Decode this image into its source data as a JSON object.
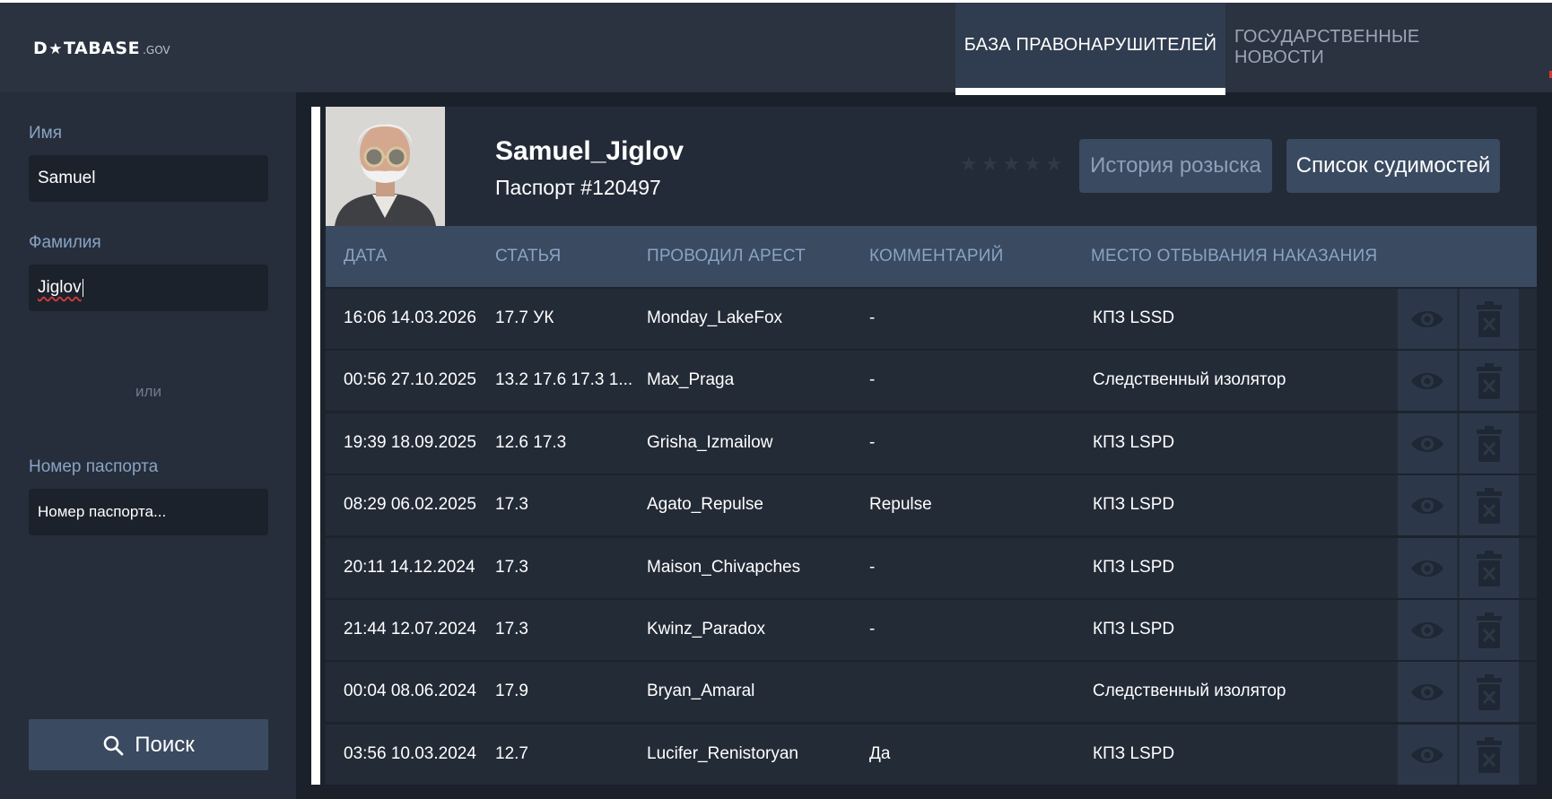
{
  "header": {
    "logo": {
      "main_before": "D",
      "main_after": "TABASE",
      "suffix": ".GOV"
    },
    "tabs": [
      {
        "label": "БАЗА ПРАВОНАРУШИТЕЛЕЙ",
        "active": true
      },
      {
        "label": "ГОСУДАРСТВЕННЫЕ НОВОСТИ",
        "active": false
      }
    ]
  },
  "sidebar": {
    "first_name_label": "Имя",
    "first_name_value": "Samuel",
    "last_name_label": "Фамилия",
    "last_name_value": "Jiglov",
    "or_text": "или",
    "passport_label": "Номер паспорта",
    "passport_placeholder": "Номер паспорта...",
    "search_button": "Поиск"
  },
  "profile": {
    "name": "Samuel_Jiglov",
    "passport": "Паспорт #120497",
    "wanted_stars": 5,
    "wanted_level": 0,
    "history_button": "История розыска",
    "convictions_button": "Список судимостей"
  },
  "table": {
    "columns": [
      "ДАТА",
      "СТАТЬЯ",
      "ПРОВОДИЛ АРЕСТ",
      "КОММЕНТАРИЙ",
      "МЕСТО ОТБЫВАНИЯ НАКАЗАНИЯ"
    ],
    "rows": [
      {
        "date": "16:06 14.03.2026",
        "article": "17.7 УК",
        "officer": "Monday_LakeFox",
        "comment": "-",
        "place": "КПЗ LSSD"
      },
      {
        "date": "00:56 27.10.2025",
        "article": "13.2 17.6 17.3 1...",
        "officer": "Max_Praga",
        "comment": "-",
        "place": "Следственный изолятор"
      },
      {
        "date": "19:39 18.09.2025",
        "article": "12.6 17.3",
        "officer": "Grisha_Izmailow",
        "comment": "-",
        "place": "КПЗ LSPD"
      },
      {
        "date": "08:29 06.02.2025",
        "article": "17.3",
        "officer": "Agato_Repulse",
        "comment": "Repulse",
        "place": "КПЗ LSPD"
      },
      {
        "date": "20:11 14.12.2024",
        "article": "17.3",
        "officer": "Maison_Chivapches",
        "comment": "-",
        "place": "КПЗ LSPD"
      },
      {
        "date": "21:44 12.07.2024",
        "article": "17.3",
        "officer": "Kwinz_Paradox",
        "comment": "-",
        "place": "КПЗ LSPD"
      },
      {
        "date": "00:04 08.06.2024",
        "article": "17.9",
        "officer": "Bryan_Amaral",
        "comment": "",
        "place": "Следственный изолятор"
      },
      {
        "date": "03:56 10.03.2024",
        "article": "12.7",
        "officer": "Lucifer_Renistoryan",
        "comment": "Да",
        "place": "КПЗ LSPD"
      }
    ],
    "row_actions": [
      "eye-icon",
      "delete-icon"
    ]
  },
  "colors": {
    "topbar": "#2b3340",
    "sidebar": "#262e3b",
    "accent_button": "#394a61",
    "label": "#8aa3c4",
    "row": "#232b37"
  }
}
